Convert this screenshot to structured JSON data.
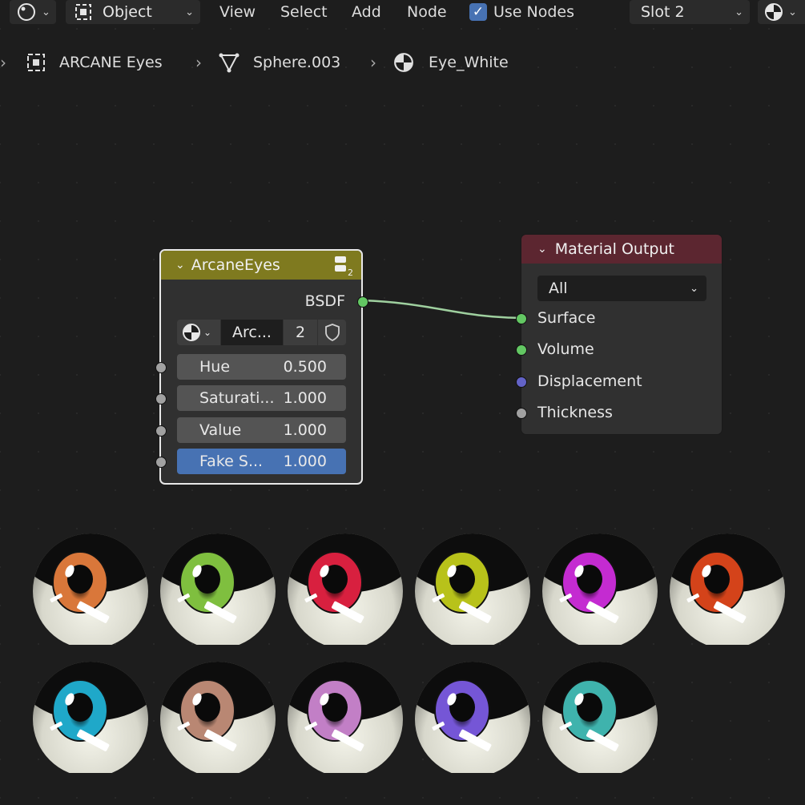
{
  "header": {
    "editor_type_icon": "node-editor-icon",
    "mode_label": "Object",
    "menus": [
      "View",
      "Select",
      "Add",
      "Node"
    ],
    "use_nodes_label": "Use Nodes",
    "use_nodes_checked": true,
    "slot_label": "Slot 2",
    "material_icon": "material-sphere-icon"
  },
  "breadcrumb": {
    "object": "ARCANE Eyes",
    "mesh": "Sphere.003",
    "material": "Eye_White"
  },
  "arcane_node": {
    "title": "ArcaneEyes",
    "output_label": "BSDF",
    "datablock_name": "Arc...",
    "user_count": "2",
    "inputs": [
      {
        "label": "Hue",
        "value": "0.500"
      },
      {
        "label": "Saturati...",
        "value": "1.000"
      },
      {
        "label": "Value",
        "value": "1.000"
      },
      {
        "label": "Fake S...",
        "value": "1.000"
      }
    ],
    "header_color": "#7f7a1f"
  },
  "output_node": {
    "title": "Material Output",
    "target": "All",
    "inputs": [
      "Surface",
      "Volume",
      "Displacement",
      "Thickness"
    ],
    "header_color": "#5c2630"
  },
  "eyes": [
    {
      "iris": "#d9773a"
    },
    {
      "iris": "#7fbf3f"
    },
    {
      "iris": "#d8203f"
    },
    {
      "iris": "#b8c21a"
    },
    {
      "iris": "#c42bd1"
    },
    {
      "iris": "#d4431a"
    },
    {
      "iris": "#1fa8c9"
    },
    {
      "iris": "#b98773"
    },
    {
      "iris": "#c27fc6"
    },
    {
      "iris": "#7556d6"
    },
    {
      "iris": "#3fb3ad"
    }
  ]
}
